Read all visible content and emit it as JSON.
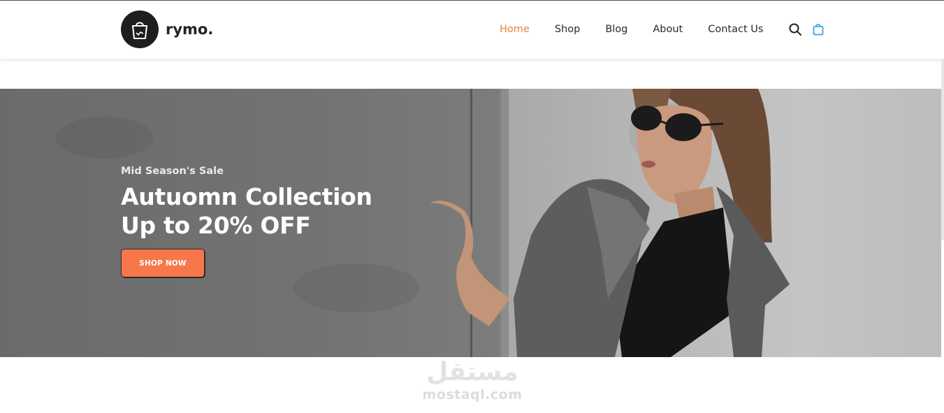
{
  "header": {
    "brand": "rymo.",
    "logo_icon": "shopping-bag-icon",
    "nav": [
      {
        "label": "Home",
        "active": true
      },
      {
        "label": "Shop",
        "active": false
      },
      {
        "label": "Blog",
        "active": false
      },
      {
        "label": "About",
        "active": false
      },
      {
        "label": "Contact Us",
        "active": false
      }
    ],
    "search_icon": "search-icon",
    "cart_icon": "shopping-bag-icon"
  },
  "hero": {
    "eyebrow": "Mid Season's Sale",
    "headline_line1": "Autuomn Collection",
    "headline_line2": "Up to 20% OFF",
    "cta_label": "SHOP NOW",
    "image": "fashion-model-photo"
  },
  "watermark": {
    "arabic": "مستقل",
    "latin": "mostaql.com"
  },
  "colors": {
    "accent_nav": "#e8833f",
    "cta_bg": "#f6784a",
    "cart_icon": "#3ea3e0",
    "logo_bg": "#1e1e1e"
  }
}
